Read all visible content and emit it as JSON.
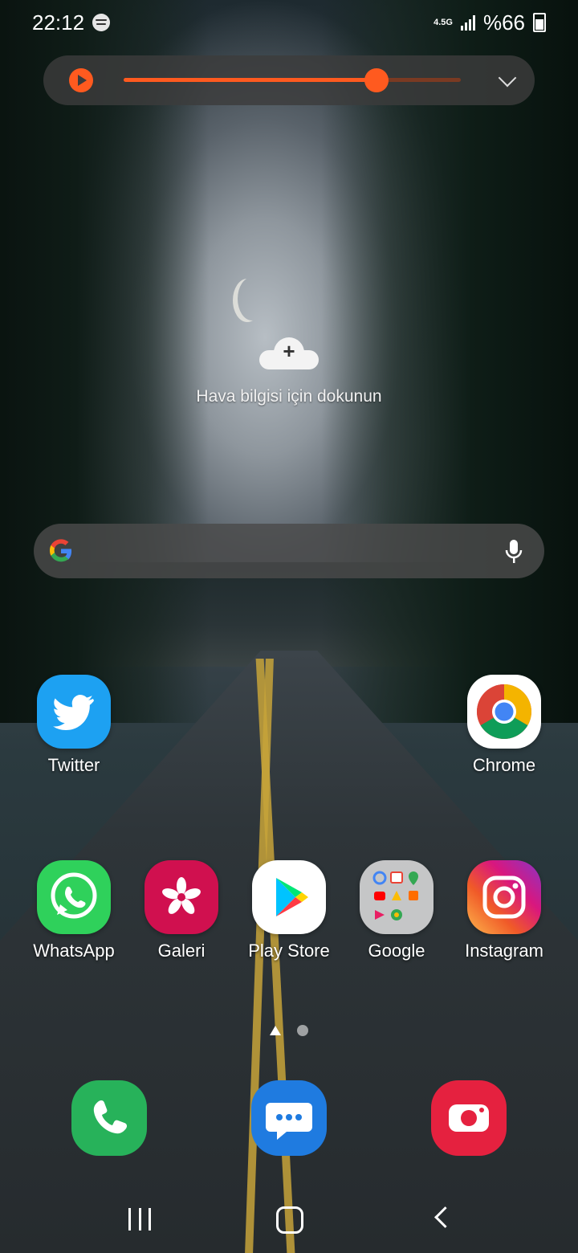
{
  "status_bar": {
    "time": "22:12",
    "network_type": "4.5G",
    "battery_text": "%66"
  },
  "media_widget": {
    "progress": 0.75,
    "accent_color": "#ff5a1f"
  },
  "weather": {
    "prompt": "Hava bilgisi için dokunun"
  },
  "apps_row1": [
    {
      "label": "Twitter",
      "icon": "twitter-icon"
    },
    {
      "label": "Chrome",
      "icon": "chrome-icon"
    }
  ],
  "apps_row2": [
    {
      "label": "WhatsApp",
      "icon": "whatsapp-icon"
    },
    {
      "label": "Galeri",
      "icon": "gallery-icon"
    },
    {
      "label": "Play Store",
      "icon": "play-store-icon"
    },
    {
      "label": "Google",
      "icon": "google-folder-icon"
    },
    {
      "label": "Instagram",
      "icon": "instagram-icon"
    }
  ],
  "dock": [
    {
      "icon": "phone-icon",
      "color": "#27b25a"
    },
    {
      "icon": "messages-icon",
      "color": "#1f7be0"
    },
    {
      "icon": "camera-icon",
      "color": "#e5213f"
    }
  ]
}
